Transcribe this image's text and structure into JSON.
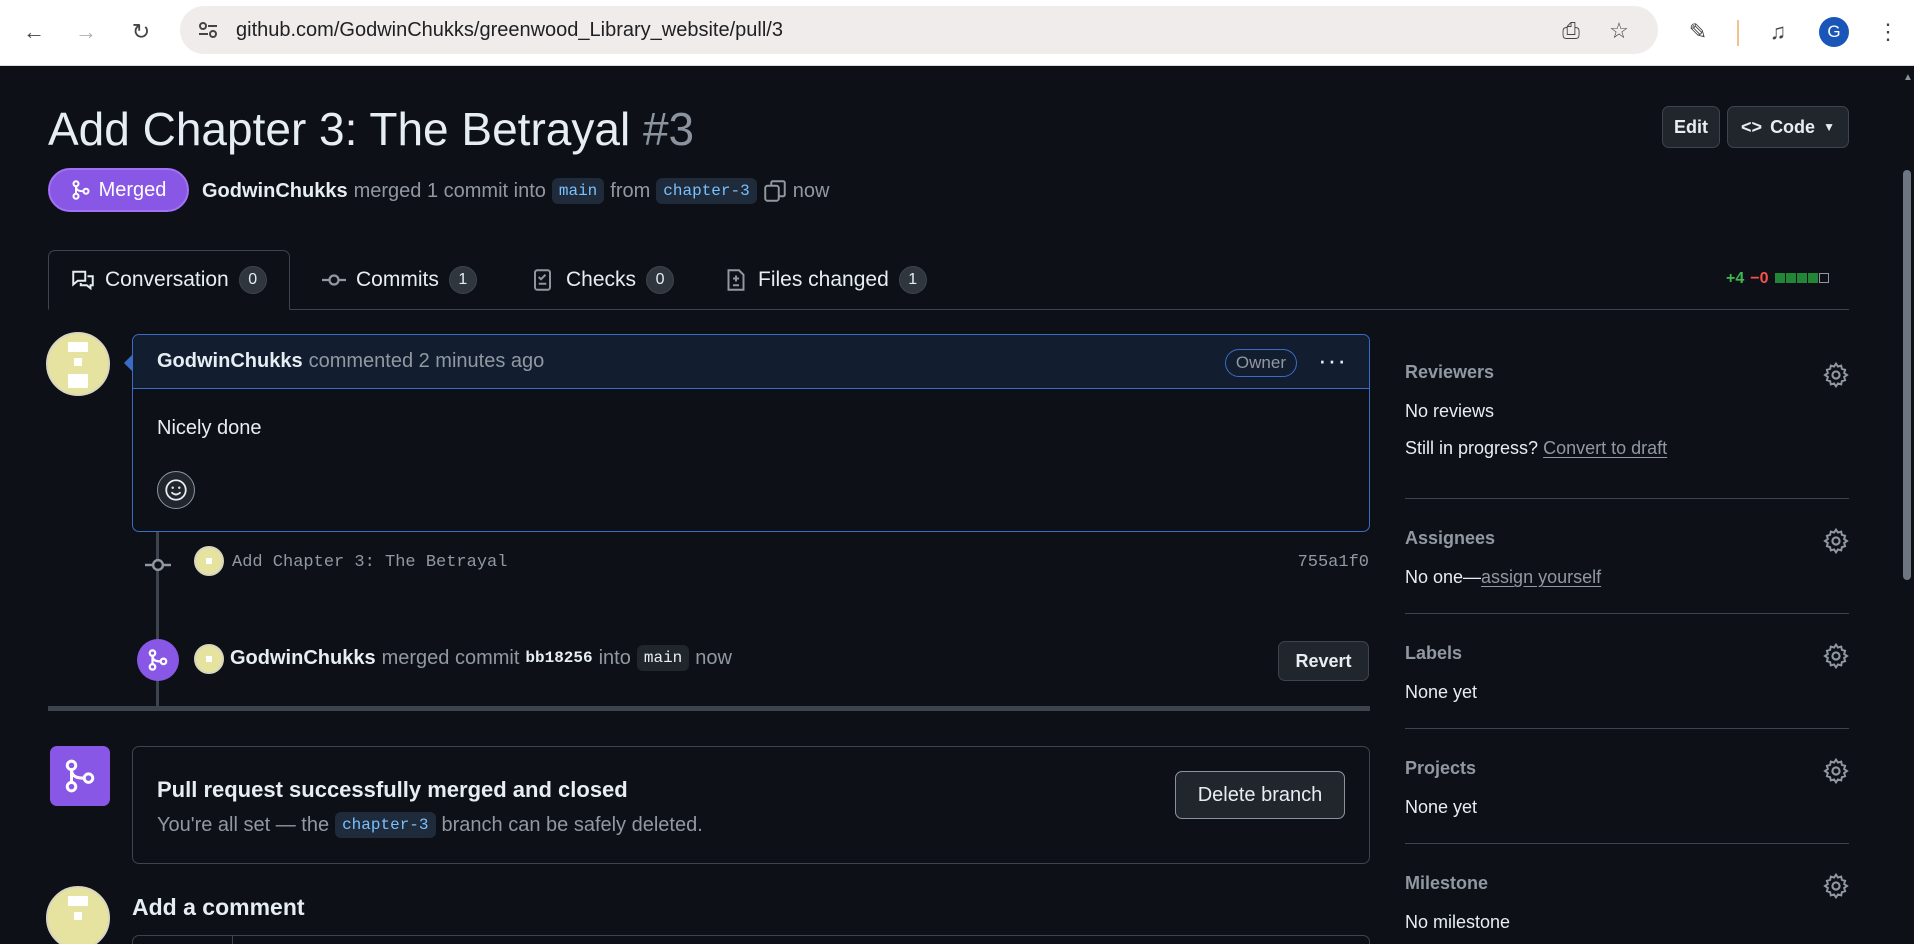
{
  "browser": {
    "url": "github.com/GodwinChukks/greenwood_Library_website/pull/3",
    "profile_initial": "G"
  },
  "pr": {
    "title": "Add Chapter 3: The Betrayal",
    "number": "#3",
    "edit_label": "Edit",
    "code_label": "Code",
    "state_label": "Merged",
    "author": "GodwinChukks",
    "merge_text": "merged 1 commit into",
    "base_branch": "main",
    "from_text": "from",
    "head_branch": "chapter-3",
    "time": "now"
  },
  "tabs": [
    {
      "label": "Conversation",
      "count": "0"
    },
    {
      "label": "Commits",
      "count": "1"
    },
    {
      "label": "Checks",
      "count": "0"
    },
    {
      "label": "Files changed",
      "count": "1"
    }
  ],
  "diffstat": {
    "additions": "+4",
    "deletions": "−0"
  },
  "comment": {
    "author": "GodwinChukks",
    "meta": "commented 2 minutes ago",
    "role": "Owner",
    "body": "Nicely done"
  },
  "commit_event": {
    "message": "Add Chapter 3: The Betrayal",
    "sha": "755a1f0"
  },
  "merge_event": {
    "author": "GodwinChukks",
    "text": "merged commit",
    "sha": "bb18256",
    "into": "into",
    "branch": "main",
    "time": "now",
    "revert_label": "Revert"
  },
  "merged_box": {
    "title": "Pull request successfully merged and closed",
    "desc_before": "You're all set — the",
    "branch": "chapter-3",
    "desc_after": "branch can be safely deleted.",
    "delete_label": "Delete branch"
  },
  "add_comment_label": "Add a comment",
  "sidebar": {
    "reviewers": {
      "label": "Reviewers",
      "value": "No reviews",
      "draft_prefix": "Still in progress?",
      "draft_link": "Convert to draft"
    },
    "assignees": {
      "label": "Assignees",
      "value_prefix": "No one—",
      "value_link": "assign yourself"
    },
    "labels": {
      "label": "Labels",
      "value": "None yet"
    },
    "projects": {
      "label": "Projects",
      "value": "None yet"
    },
    "milestone": {
      "label": "Milestone",
      "value": "No milestone"
    }
  },
  "colors": {
    "merged": "#8957e5",
    "accent_blue": "#3b6cc5",
    "background": "#0d1117",
    "additions": "#3fb950",
    "deletions": "#f85149"
  }
}
